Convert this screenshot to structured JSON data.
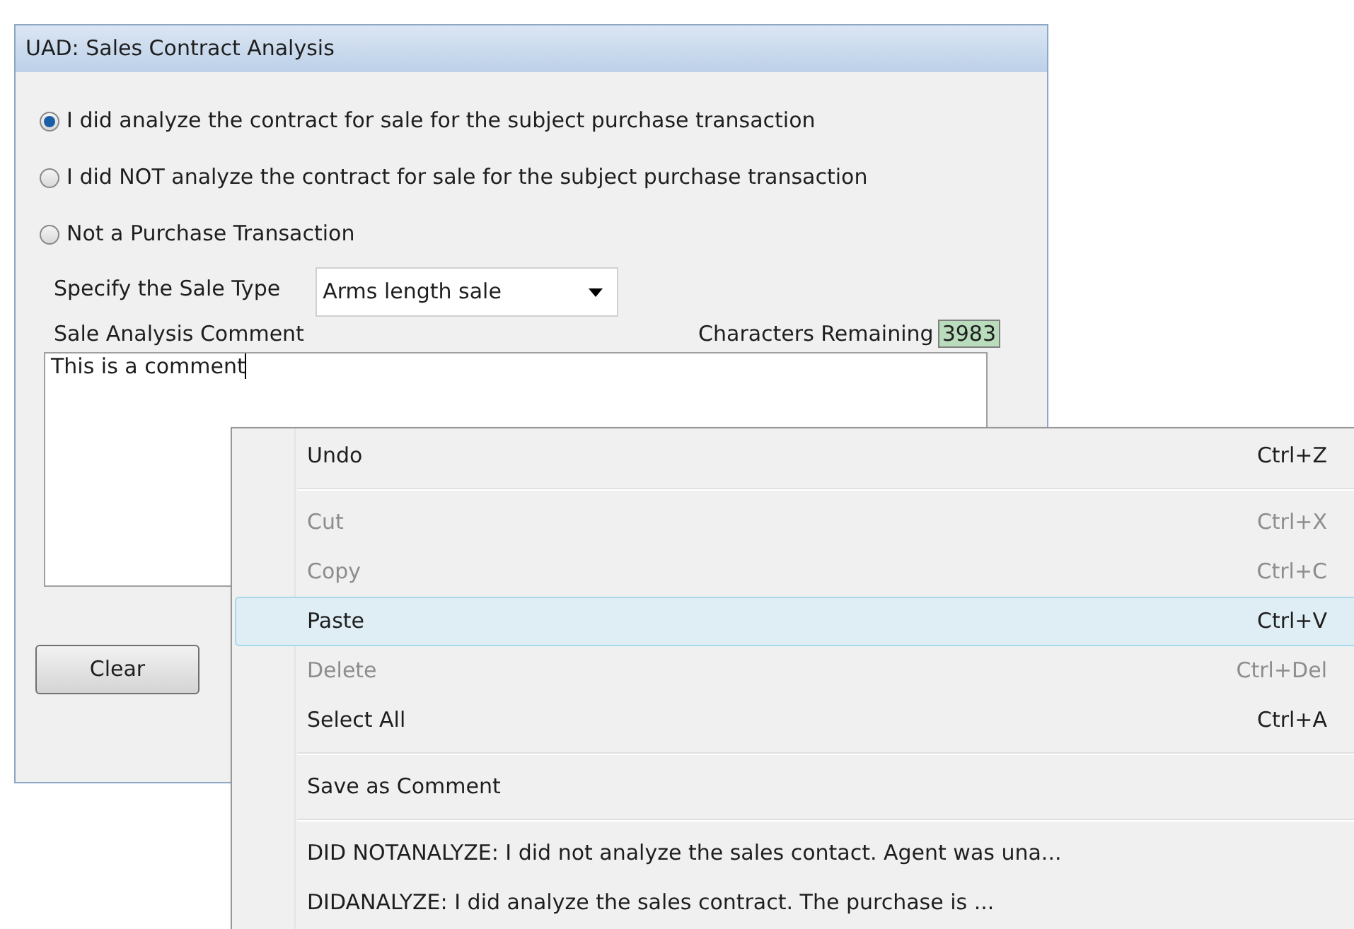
{
  "window": {
    "title": "UAD: Sales Contract Analysis"
  },
  "options": [
    {
      "label": "I did analyze the contract for sale for the subject purchase transaction",
      "selected": true
    },
    {
      "label": "I did NOT analyze the contract for sale for the subject purchase transaction",
      "selected": false
    },
    {
      "label": "Not a Purchase Transaction",
      "selected": false
    }
  ],
  "sale_type": {
    "label": "Specify the Sale Type",
    "value": "Arms length sale"
  },
  "comment": {
    "label": "Sale Analysis Comment",
    "remaining_label": "Characters Remaining",
    "remaining": "3983",
    "value": "This is a comment"
  },
  "buttons": [
    "Clear"
  ],
  "context_menu": [
    {
      "kind": "item",
      "label": "Undo",
      "shortcut": "Ctrl+Z",
      "disabled": false,
      "selected": false
    },
    {
      "kind": "separator"
    },
    {
      "kind": "item",
      "label": "Cut",
      "shortcut": "Ctrl+X",
      "disabled": true,
      "selected": false
    },
    {
      "kind": "item",
      "label": "Copy",
      "shortcut": "Ctrl+C",
      "disabled": true,
      "selected": false
    },
    {
      "kind": "item",
      "label": "Paste",
      "shortcut": "Ctrl+V",
      "disabled": false,
      "selected": true
    },
    {
      "kind": "item",
      "label": "Delete",
      "shortcut": "Ctrl+Del",
      "disabled": true,
      "selected": false
    },
    {
      "kind": "item",
      "label": "Select All",
      "shortcut": "Ctrl+A",
      "disabled": false,
      "selected": false
    },
    {
      "kind": "separator"
    },
    {
      "kind": "item",
      "label": "Save as Comment",
      "disabled": false,
      "selected": false
    },
    {
      "kind": "separator"
    },
    {
      "kind": "item",
      "label": "DID NOTANALYZE:  I did not analyze the sales contact. Agent was una...",
      "disabled": false,
      "selected": false
    },
    {
      "kind": "item",
      "label": "DIDANALYZE:  I did analyze the sales contract. The purchase is ...",
      "disabled": false,
      "selected": false
    }
  ]
}
